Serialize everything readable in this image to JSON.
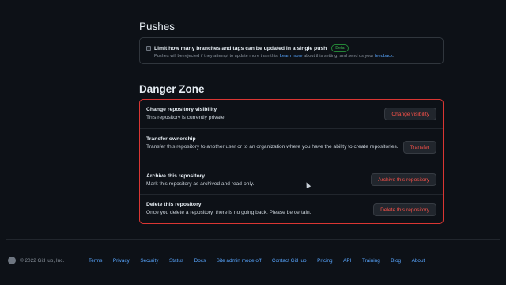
{
  "pushes": {
    "title": "Pushes",
    "label": "Limit how many branches and tags can be updated in a single push",
    "badge": "Beta",
    "desc_prefix": "Pushes will be rejected if they attempt to update more than this.",
    "learn_more": "Learn more",
    "desc_middle": "about this setting, and send us your",
    "feedback": "feedback",
    "desc_suffix": "."
  },
  "danger": {
    "title": "Danger Zone",
    "rows": [
      {
        "title": "Change repository visibility",
        "desc": "This repository is currently private.",
        "button": "Change visibility"
      },
      {
        "title": "Transfer ownership",
        "desc": "Transfer this repository to another user or to an organization where you have the ability to create repositories.",
        "button": "Transfer"
      },
      {
        "title": "Archive this repository",
        "desc": "Mark this repository as archived and read-only.",
        "button": "Archive this repository"
      },
      {
        "title": "Delete this repository",
        "desc": "Once you delete a repository, there is no going back. Please be certain.",
        "button": "Delete this repository"
      }
    ]
  },
  "footer": {
    "copyright": "© 2022 GitHub, Inc.",
    "links": [
      "Terms",
      "Privacy",
      "Security",
      "Status",
      "Docs",
      "Site admin mode off",
      "Contact GitHub",
      "Pricing",
      "API",
      "Training",
      "Blog",
      "About"
    ]
  }
}
